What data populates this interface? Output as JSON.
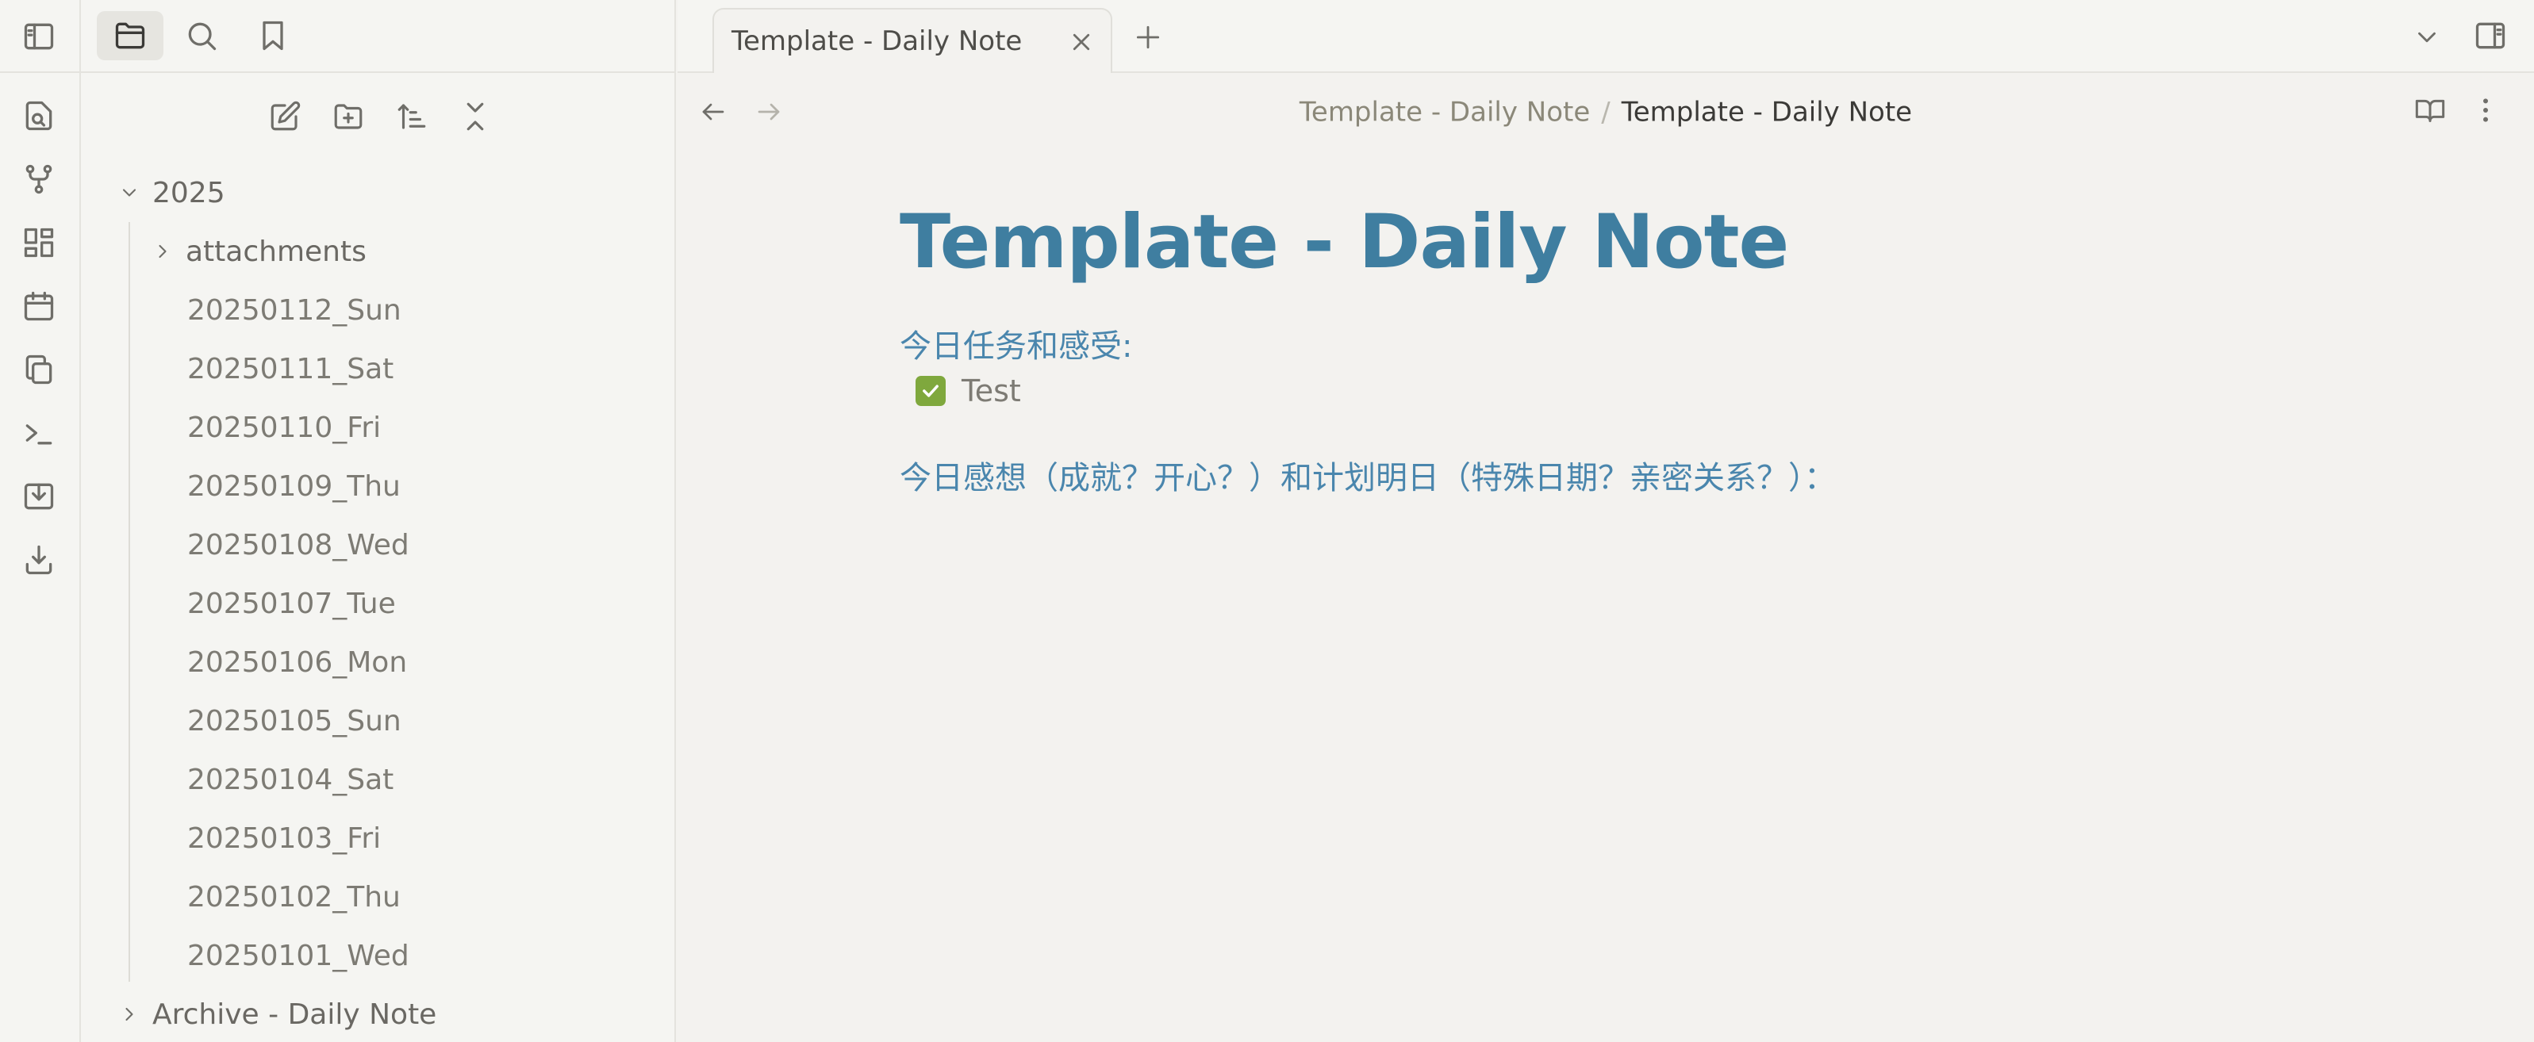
{
  "ribbon": {
    "icons": [
      "sidebar-toggle-icon",
      "file-search-icon",
      "graph-icon",
      "grid-icon",
      "calendar-icon",
      "copy-icon",
      "terminal-icon",
      "import-icon",
      "download-icon"
    ]
  },
  "sidebar": {
    "tabs": [
      "files-icon",
      "search-icon",
      "bookmark-icon"
    ],
    "actions": [
      "new-note-icon",
      "new-folder-icon",
      "sort-icon",
      "collapse-all-icon"
    ],
    "tree": {
      "root_folder": "2025",
      "subfolder": "attachments",
      "files": [
        "20250112_Sun",
        "20250111_Sat",
        "20250110_Fri",
        "20250109_Thu",
        "20250108_Wed",
        "20250107_Tue",
        "20250106_Mon",
        "20250105_Sun",
        "20250104_Sat",
        "20250103_Fri",
        "20250102_Thu",
        "20250101_Wed"
      ],
      "archive_folder": "Archive - Daily Note"
    }
  },
  "tab": {
    "title": "Template - Daily Note"
  },
  "breadcrumb": {
    "parent": "Template - Daily Note",
    "separator": "/",
    "current": "Template - Daily Note"
  },
  "note": {
    "title": "Template - Daily Note",
    "heading1": "今日任务和感受:",
    "task": {
      "label": "Test",
      "checked": true
    },
    "heading2": "今日感想（成就？开心？）和计划明日（特殊日期？亲密关系？）："
  },
  "colors": {
    "accent": "#3f7ea0",
    "checkbox": "#7fa83d",
    "background": "#f3f2ef"
  }
}
